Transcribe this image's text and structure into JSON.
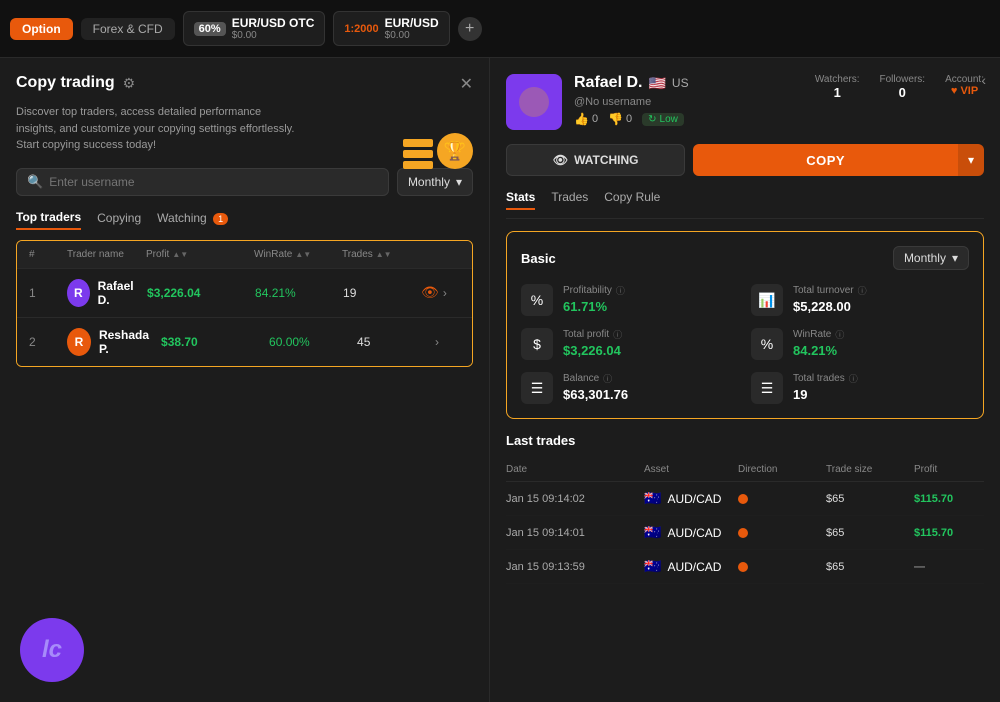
{
  "topbar": {
    "tab_option": "Option",
    "tab_forex": "Forex & CFD",
    "instrument1": {
      "pct": "60%",
      "ratio": "",
      "name": "EUR/USD OTC",
      "price": "$0.00"
    },
    "instrument2": {
      "ratio": "1:2000",
      "name": "EUR/USD",
      "price": "$0.00"
    },
    "add_label": "+"
  },
  "left_panel": {
    "title": "Copy trading",
    "description": "Discover top traders, access detailed performance insights, and customize your copying settings effortlessly.\nStart copying success today!",
    "search_placeholder": "Enter username",
    "monthly_label": "Monthly",
    "tabs": [
      {
        "label": "Top traders",
        "active": true
      },
      {
        "label": "Copying",
        "active": false
      },
      {
        "label": "Watching",
        "active": false,
        "badge": "1"
      }
    ],
    "table_headers": [
      "#",
      "Trader name",
      "Profit",
      "WinRate",
      "Trades",
      ""
    ],
    "traders": [
      {
        "rank": "1",
        "name": "Rafael D.",
        "profit": "$3,226.04",
        "winrate": "84.21%",
        "trades": "19",
        "avatar_letter": "R",
        "avatar_color": "purple"
      },
      {
        "rank": "2",
        "name": "Reshada P.",
        "profit": "$38.70",
        "winrate": "60.00%",
        "trades": "45",
        "avatar_letter": "R",
        "avatar_color": "orange"
      }
    ]
  },
  "right_panel": {
    "profile": {
      "name": "Rafael D.",
      "flag": "🇺🇸",
      "country": "US",
      "username": "@No username",
      "likes": "0",
      "dislikes": "0",
      "risk_level": "Low",
      "watchers_label": "Watchers:",
      "watchers_value": "1",
      "followers_label": "Followers:",
      "followers_value": "0",
      "account_label": "Account:",
      "account_value": "VIP"
    },
    "watch_btn": "WATCHING",
    "copy_btn": "COPY",
    "stats_tabs": [
      "Stats",
      "Trades",
      "Copy Rule"
    ],
    "basic_title": "Basic",
    "monthly_label": "Monthly",
    "stats": [
      {
        "name": "Profitability",
        "value": "61.71%",
        "icon": "%"
      },
      {
        "name": "Total turnover",
        "value": "$5,228.00",
        "icon": "📊"
      },
      {
        "name": "Total profit",
        "value": "$3,226.04",
        "icon": "$"
      },
      {
        "name": "WinRate",
        "value": "84.21%",
        "icon": "%"
      },
      {
        "name": "Balance",
        "value": "$63,301.76",
        "icon": "≡"
      },
      {
        "name": "Total trades",
        "value": "19",
        "icon": "≡"
      }
    ],
    "last_trades_title": "Last trades",
    "trades_headers": [
      "Date",
      "Asset",
      "Direction",
      "Trade size",
      "Profit"
    ],
    "trades": [
      {
        "date": "Jan 15 09:14:02",
        "asset": "AUD/CAD",
        "asset_flag": "🇦🇺",
        "direction": "sell",
        "size": "$65",
        "profit": "$115.70"
      },
      {
        "date": "Jan 15 09:14:01",
        "asset": "AUD/CAD",
        "asset_flag": "🇦🇺",
        "direction": "sell",
        "size": "$65",
        "profit": "$115.70"
      },
      {
        "date": "Jan 15 09:13:59",
        "asset": "AUD/CAD",
        "asset_flag": "🇦🇺",
        "direction": "sell",
        "size": "$65",
        "profit": "—"
      }
    ]
  }
}
